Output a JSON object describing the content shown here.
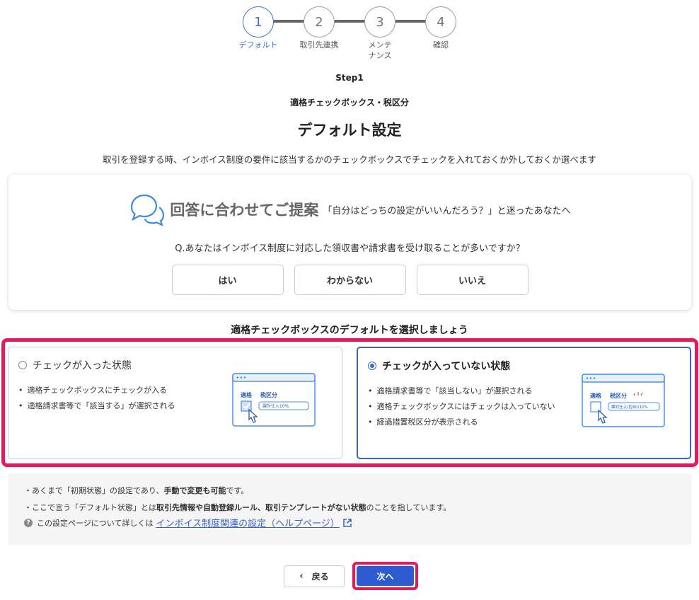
{
  "stepper": {
    "steps": [
      {
        "number": "1",
        "label": "デフォルト"
      },
      {
        "number": "2",
        "label": "取引先連携"
      },
      {
        "number": "3",
        "label_line1": "メンテ",
        "label_line2": "ナンス"
      },
      {
        "number": "4",
        "label": "確認"
      }
    ]
  },
  "header": {
    "step": "Step1",
    "subtitle": "適格チェックボックス・税区分",
    "title": "デフォルト設定",
    "description": "取引を登録する時、インボイス制度の要件に該当するかのチェックボックスでチェックを入れておくか外しておくか選べます"
  },
  "suggestion": {
    "title": "回答に合わせてご提案",
    "tagline": "「自分はどっちの設定がいいんだろう？」と迷ったあなたへ",
    "question": "Q.あなたはインボイス制度に対応した領収書や請求書を受け取ることが多いですか？",
    "answers": [
      "はい",
      "わからない",
      "いいえ"
    ]
  },
  "choose_title": "適格チェックボックスのデフォルトを選択しましょう",
  "options": {
    "checked": {
      "title": "チェックが入った状態",
      "bullets": [
        "適格チェックボックスにチェックが入る",
        "適格請求書等で「該当する」が選択される"
      ],
      "illus": {
        "col1": "適格",
        "col2": "税区分",
        "field": "課対仕入10%"
      }
    },
    "unchecked": {
      "title": "チェックが入っていない状態",
      "bullets": [
        "適格請求書等で「該当しない」が選択される",
        "適格チェックボックスにはチェックは入っていない",
        "経過措置税区分が表示される"
      ],
      "illus": {
        "col1": "適格",
        "col2": "税区分",
        "field": "課対仕入(控80)10%"
      }
    }
  },
  "notes": {
    "note1_a": "・あくまで「初期状態」の設定であり、",
    "note1_b": "手動で変更も可能",
    "note1_c": "です。",
    "note2_a": "・ここで言う「デフォルト状態」とは",
    "note2_b": "取引先情報や自動登録ルール、取引テンプレートがない状態",
    "note2_c": "のことを指しています。",
    "help_prefix": "この設定ページについて詳しくは",
    "help_link": "インボイス制度関連の設定（ヘルプページ）"
  },
  "footer": {
    "back_label": "戻る",
    "next_label": "次へ"
  },
  "colors": {
    "accent": "#3a64c8",
    "highlight": "#e6195a",
    "primary_button": "#2f5bd0"
  }
}
